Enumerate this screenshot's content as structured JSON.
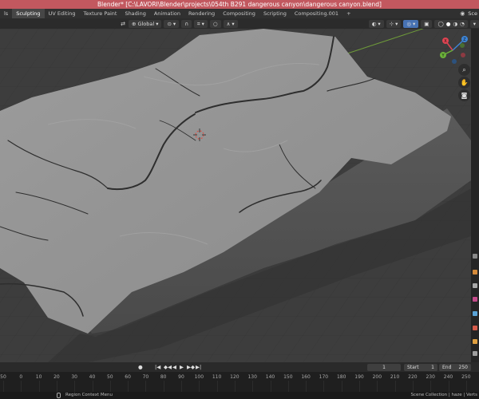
{
  "window": {
    "title": "Blender* [C:\\LAVORI\\Blender\\projects\\054th B291 dangerous canyon\\dangerous canyon.blend]"
  },
  "workspaces": {
    "tabs": [
      "Sculpting",
      "UV Editing",
      "Texture Paint",
      "Shading",
      "Animation",
      "Rendering",
      "Compositing",
      "Scripting",
      "Compositing.001"
    ],
    "first_partial": "ls",
    "active": "Sculpting",
    "scene_label": "Sce"
  },
  "viewport_header": {
    "transform_orientation": "Global",
    "snap_icon": "magnet-icon",
    "proportional_icon": "circle-icon"
  },
  "navigation": {
    "axes": {
      "x": "X",
      "y": "Y",
      "z": "Z"
    },
    "axis_colors": {
      "x": "#e04452",
      "y": "#6bb23a",
      "z": "#3d85d8"
    },
    "zoom_icon": "magnifier-icon",
    "pan_icon": "hand-icon",
    "camera_icon": "camera-icon"
  },
  "playback": {
    "current_frame": "1",
    "start_label": "Start",
    "start_value": "1",
    "end_label": "End",
    "end_value": "250"
  },
  "timeline": {
    "ticks": [
      "50",
      "0",
      "10",
      "20",
      "30",
      "40",
      "50",
      "60",
      "70",
      "80",
      "90",
      "100",
      "110",
      "120",
      "130",
      "140",
      "150",
      "160",
      "170",
      "180",
      "190",
      "200",
      "210",
      "220",
      "230",
      "240",
      "250"
    ]
  },
  "status": {
    "left": "Region Context Menu",
    "right": "Scene Collection | haze | Verts"
  },
  "colors": {
    "accent": "#4772b3",
    "titlebar": "#c2585f",
    "grid": "#3d3d3d"
  }
}
